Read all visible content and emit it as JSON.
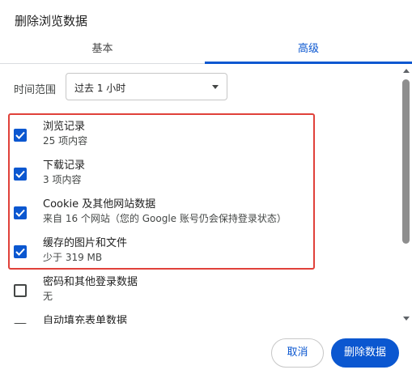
{
  "dialog": {
    "title": "删除浏览数据"
  },
  "tabs": [
    {
      "label": "基本",
      "active": false
    },
    {
      "label": "高级",
      "active": true
    }
  ],
  "time_range": {
    "label": "时间范围",
    "value": "过去 1 小时"
  },
  "items": [
    {
      "title": "浏览记录",
      "subtitle": "25 项内容",
      "checked": true
    },
    {
      "title": "下载记录",
      "subtitle": "3 项内容",
      "checked": true
    },
    {
      "title": "Cookie 及其他网站数据",
      "subtitle": "来自 16 个网站（您的 Google 账号仍会保持登录状态）",
      "checked": true
    },
    {
      "title": "缓存的图片和文件",
      "subtitle": "少于 319 MB",
      "checked": true
    },
    {
      "title": "密码和其他登录数据",
      "subtitle": "无",
      "checked": false
    },
    {
      "title": "自动填充表单数据",
      "subtitle": "",
      "checked": false
    }
  ],
  "buttons": {
    "cancel": "取消",
    "delete": "删除数据"
  },
  "colors": {
    "accent": "#0b57d0",
    "highlight": "#e0413a"
  }
}
